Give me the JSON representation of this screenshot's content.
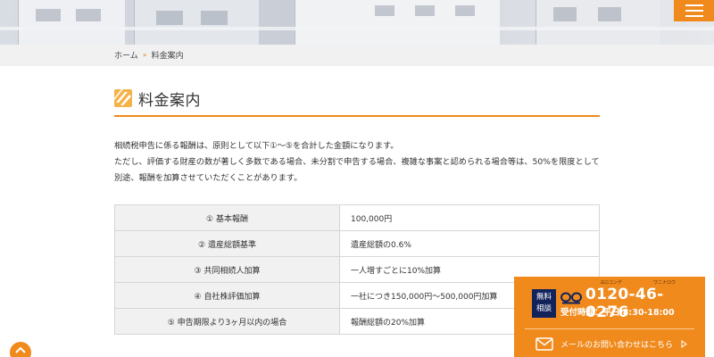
{
  "header": {
    "menu_icon": "hamburger-icon",
    "accent": "#f08a1c"
  },
  "breadcrumb": {
    "home": "ホーム",
    "separator": "»",
    "current": "料金案内"
  },
  "heading": {
    "icon": "stripes-logo-icon",
    "title": "料金案内"
  },
  "intro": {
    "line1": "相続税申告に係る報酬は、原則として以下①〜⑤を合計した金額になります。",
    "line2": "ただし、評価する財産の数が著しく多数である場合、未分割で申告する場合、複雑な事案と認められる場合等は、50%を限度として別途、報酬を加算させていただくことがあります。"
  },
  "fees": [
    {
      "label": "① 基本報酬",
      "value": "100,000円"
    },
    {
      "label": "② 遺産総額基準",
      "value": "遺産総額の0.6%"
    },
    {
      "label": "③ 共同相続人加算",
      "value": "一人増すごとに10%加算"
    },
    {
      "label": "④ 自社株評価加算",
      "value": "一社につき150,000円〜500,000円加算"
    },
    {
      "label": "⑤ 申告期限より3ヶ月以内の場合",
      "value": "報酬総額の20%加算"
    }
  ],
  "contact": {
    "badge_line1": "無料",
    "badge_line2": "相談",
    "ruby1": "ヨロコンデ",
    "ruby2": "ワニナロウ",
    "freedial_icon": "free-dial-icon",
    "phone": "0120-46-0276",
    "hours": "受付時間：平日 8:30-18:00",
    "mail_icon": "envelope-icon",
    "mail_label": "メールのお問い合わせはこちら",
    "bg_color": "#f08a1c",
    "badge_color": "#12235c"
  },
  "pagetop": {
    "icon": "chevron-up-icon"
  }
}
